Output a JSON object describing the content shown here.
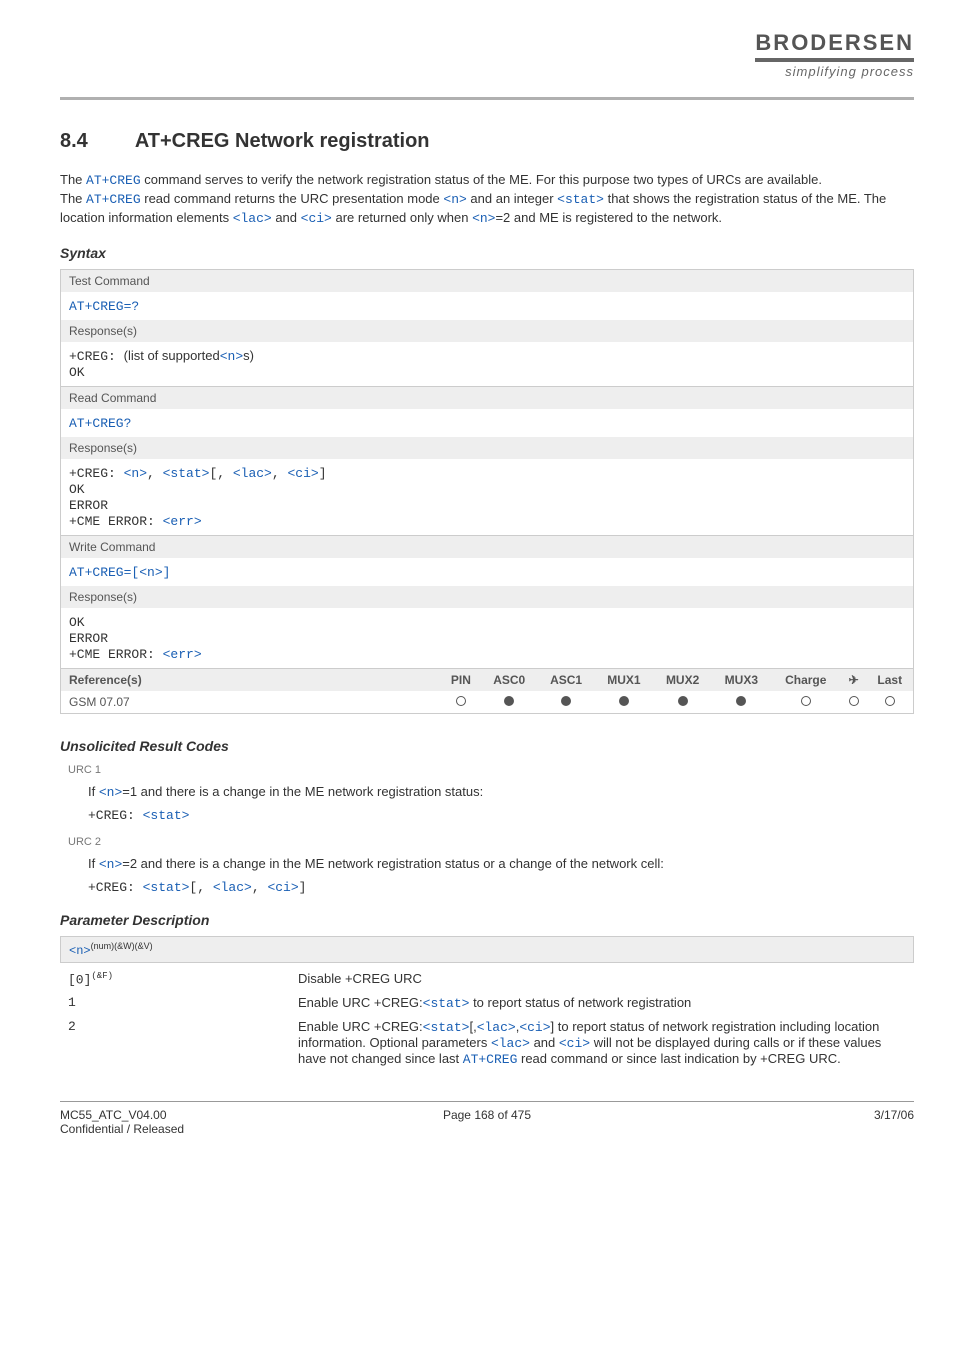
{
  "brand": {
    "name": "BRODERSEN",
    "tagline": "simplifying process"
  },
  "section": {
    "number": "8.4",
    "title": "AT+CREG   Network registration"
  },
  "intro": {
    "p1a": "The ",
    "p1cmd": "AT+CREG",
    "p1b": " command serves to verify the network registration status of the ME. For this purpose two types of URCs are available.",
    "p2a": "The ",
    "p2cmd": "AT+CREG",
    "p2b": " read command returns the URC presentation mode ",
    "p2n": "<n>",
    "p2c": " and an integer ",
    "p2stat": "<stat>",
    "p2d": " that shows the registration status of the ME. The location information elements ",
    "p2lac": "<lac>",
    "p2e": " and ",
    "p2ci": "<ci>",
    "p2f": " are returned only when ",
    "p2n2": "<n>",
    "p2g": "=2 and ME is registered to the network."
  },
  "syntax_label": "Syntax",
  "blocks": {
    "test": {
      "hdr": "Test Command",
      "cmd": "AT+CREG=?",
      "resp_hdr": "Response(s)",
      "resp1a": "+CREG: ",
      "resp1b": "(list of supported",
      "resp1n": "<n>",
      "resp1c": "s)",
      "ok": "OK"
    },
    "read": {
      "hdr": "Read Command",
      "cmd": "AT+CREG?",
      "resp_hdr": "Response(s)",
      "line1a": "+CREG: ",
      "n": "<n>",
      "sep1": ", ",
      "stat": "<stat>",
      "sep2": "[, ",
      "lac": "<lac>",
      "sep3": ", ",
      "ci": "<ci>",
      "sep4": "]",
      "ok": "OK",
      "err": "ERROR",
      "cme": "+CME ERROR: ",
      "errp": "<err>"
    },
    "write": {
      "hdr": "Write Command",
      "cmd1": "AT+CREG=[",
      "n": "<n>",
      "cmd2": "]",
      "resp_hdr": "Response(s)",
      "ok": "OK",
      "err": "ERROR",
      "cme": "+CME ERROR: ",
      "errp": "<err>"
    },
    "ref": {
      "hdr": "Reference(s)",
      "val": "GSM 07.07",
      "cols": {
        "pin": "PIN",
        "asc0": "ASC0",
        "asc1": "ASC1",
        "mux1": "MUX1",
        "mux2": "MUX2",
        "mux3": "MUX3",
        "charge": "Charge",
        "airplane": "✈",
        "last": "Last"
      },
      "vals": {
        "pin": "○",
        "asc0": "●",
        "asc1": "●",
        "mux1": "●",
        "mux2": "●",
        "mux3": "●",
        "charge": "○",
        "airplane": "○",
        "last": "○"
      }
    }
  },
  "urc": {
    "heading": "Unsolicited Result Codes",
    "u1lbl": "URC 1",
    "u1a": "If ",
    "u1n": "<n>",
    "u1b": "=1 and there is a change in the ME network registration status:",
    "u1mono_a": "+CREG: ",
    "u1mono_stat": "<stat>",
    "u2lbl": "URC 2",
    "u2a": "If ",
    "u2n": "<n>",
    "u2b": "=2 and there is a change in the ME network registration status or a change of the network cell:",
    "u2mono_a": "+CREG: ",
    "u2mono_stat": "<stat>",
    "u2mono_b": "[, ",
    "u2mono_lac": "<lac>",
    "u2mono_c": ", ",
    "u2mono_ci": "<ci>",
    "u2mono_d": "]"
  },
  "params": {
    "heading": "Parameter Description",
    "hdr_n": "<n>",
    "hdr_sup": "(num)(&W)(&V)",
    "rows": [
      {
        "k": "[0]",
        "ksup": "(&F)",
        "v": "Disable +CREG URC"
      },
      {
        "k": "1",
        "ksup": "",
        "v1": "Enable URC +CREG:",
        "stat": "<stat>",
        "v2": " to report status of network registration"
      },
      {
        "k": "2",
        "ksup": "",
        "v1": "Enable URC +CREG:",
        "stat": "<stat>",
        "v2": "[,",
        "lac": "<lac>",
        "v3": ",",
        "ci": "<ci>",
        "v4": "] to report status of network registration including location information. Optional parameters ",
        "lac2": "<lac>",
        "v5": " and ",
        "ci2": "<ci>",
        "v6": " will not be displayed during calls or if these values have not changed since last ",
        "atcreg": "AT+CREG",
        "v7": " read command or since last indication by +CREG URC."
      }
    ]
  },
  "footer": {
    "left1": "MC55_ATC_V04.00",
    "left2": "Confidential / Released",
    "center": "Page 168 of 475",
    "right": "3/17/06"
  }
}
